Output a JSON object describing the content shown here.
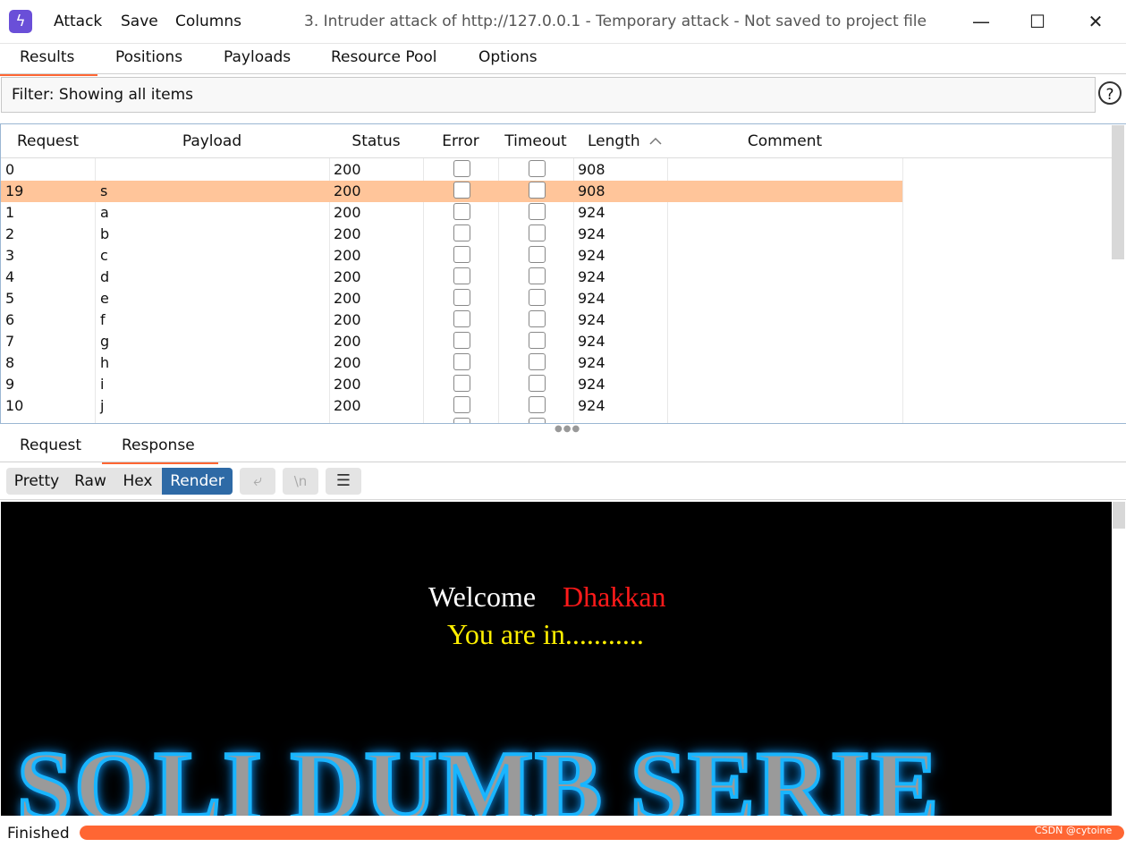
{
  "titlebar": {
    "menu": [
      "Attack",
      "Save",
      "Columns"
    ],
    "title": "3. Intruder attack of http://127.0.0.1 - Temporary attack - Not saved to project file",
    "minimize": "—",
    "maximize": "☐",
    "close": "✕"
  },
  "tabs": [
    "Results",
    "Positions",
    "Payloads",
    "Resource Pool",
    "Options"
  ],
  "filter": {
    "text": "Filter: Showing all items",
    "help": "?"
  },
  "table": {
    "columns": [
      "Request",
      "Payload",
      "Status",
      "Error",
      "Timeout",
      "Length",
      "Comment"
    ],
    "sort_indicator": "^",
    "rows": [
      {
        "request": "0",
        "payload": "",
        "status": "200",
        "length": "908"
      },
      {
        "request": "19",
        "payload": "s",
        "status": "200",
        "length": "908"
      },
      {
        "request": "1",
        "payload": "a",
        "status": "200",
        "length": "924"
      },
      {
        "request": "2",
        "payload": "b",
        "status": "200",
        "length": "924"
      },
      {
        "request": "3",
        "payload": "c",
        "status": "200",
        "length": "924"
      },
      {
        "request": "4",
        "payload": "d",
        "status": "200",
        "length": "924"
      },
      {
        "request": "5",
        "payload": "e",
        "status": "200",
        "length": "924"
      },
      {
        "request": "6",
        "payload": "f",
        "status": "200",
        "length": "924"
      },
      {
        "request": "7",
        "payload": "g",
        "status": "200",
        "length": "924"
      },
      {
        "request": "8",
        "payload": "h",
        "status": "200",
        "length": "924"
      },
      {
        "request": "9",
        "payload": "i",
        "status": "200",
        "length": "924"
      },
      {
        "request": "10",
        "payload": "j",
        "status": "200",
        "length": "924"
      }
    ],
    "selected_row": 1
  },
  "lower_tabs": [
    "Request",
    "Response"
  ],
  "view_toggles": [
    "Pretty",
    "Raw",
    "Hex",
    "Render"
  ],
  "tool_icons": [
    "wrap-icon",
    "newline-icon",
    "menu-icon"
  ],
  "tool_glyphs": [
    "⤶",
    "\\n",
    "☰"
  ],
  "render": {
    "welcome": "Welcome",
    "name": "Dhakkan",
    "status_line": "You are in...........",
    "banner": "SOLI DUMB SERIE"
  },
  "status": {
    "text": "Finished",
    "progress": 1.0
  },
  "watermark": "CSDN @cytoine",
  "colors": {
    "accent": "#ff6633",
    "selected_row": "#ffc59a",
    "active_toggle": "#2e6aa6"
  }
}
